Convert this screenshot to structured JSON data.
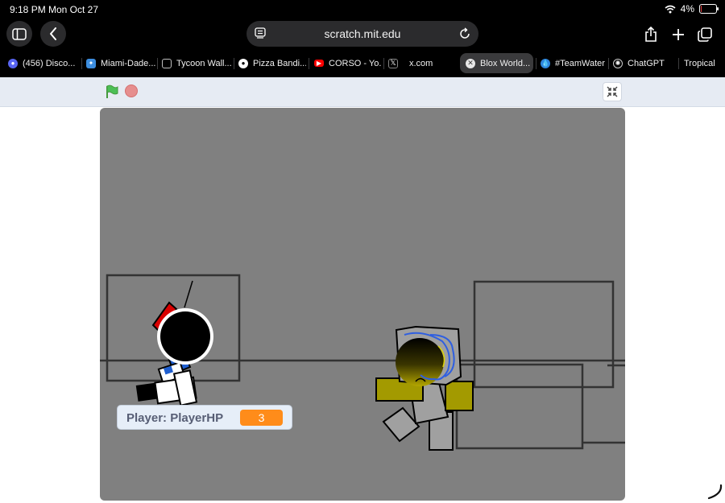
{
  "status": {
    "time": "9:18 PM",
    "date": "Mon Oct 27",
    "battery_percent": "4%",
    "battery_level": 0.04
  },
  "browser": {
    "url": "scratch.mit.edu",
    "tabs": [
      {
        "label": "(456) Disco...",
        "icon": "discord-icon",
        "color": "#5865f2"
      },
      {
        "label": "Miami-Dade...",
        "icon": "site-icon",
        "color": "#3d8ee0"
      },
      {
        "label": "Tycoon Wall...",
        "icon": "window-icon",
        "color": "#bfbfbf"
      },
      {
        "label": "Pizza Bandi...",
        "icon": "circle-site-icon",
        "color": "#ffffff"
      },
      {
        "label": "CORSO - Yo...",
        "icon": "youtube-icon",
        "color": "#ff0000"
      },
      {
        "label": "x.com",
        "icon": "x-icon",
        "color": "#000000"
      },
      {
        "label": "Blox World...",
        "icon": "close-icon",
        "color": "#ffffff",
        "active": true
      },
      {
        "label": "#TeamWater",
        "icon": "water-drop-icon",
        "color": "#2e86de"
      },
      {
        "label": "ChatGPT",
        "icon": "chatgpt-icon",
        "color": "#ffffff"
      },
      {
        "label": "Tropical",
        "icon": "",
        "color": ""
      }
    ]
  },
  "scratch": {
    "flag_color": "#4cbf56",
    "stop_color": "#e68e8e",
    "monitor": {
      "label": "Player: PlayerHP",
      "value": "3",
      "color": "#ff8c1a"
    }
  },
  "stage": {
    "background": "#808080",
    "player_colors": {
      "head": "#000000",
      "body": "#1f5fd0",
      "accent": "#d90000"
    },
    "enemy_colors": {
      "head": "#b4a600",
      "limbs": "#a39a00",
      "body": "#a0a0a0",
      "scribble": "#2f5fe0"
    }
  }
}
